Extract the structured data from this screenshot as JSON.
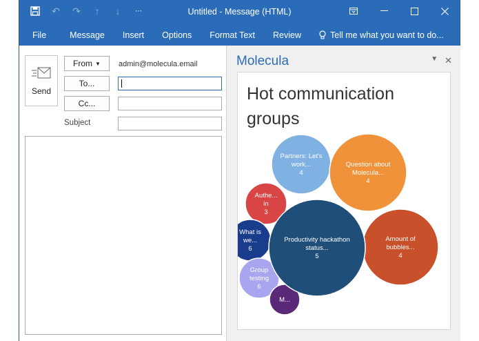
{
  "window": {
    "title": "Untitled - Message (HTML)"
  },
  "icons": [
    "save-icon",
    "undo-icon",
    "redo-icon",
    "up-icon",
    "down-icon",
    "customize-icon",
    "ribbon-display-icon",
    "minimize-icon",
    "maximize-icon",
    "close-icon"
  ],
  "ribbon": {
    "tabs": [
      "File",
      "Message",
      "Insert",
      "Options",
      "Format Text",
      "Review"
    ],
    "tell_me": "Tell me what you want to do..."
  },
  "compose": {
    "send_label": "Send",
    "from_label": "From",
    "from_value": "admin@molecula.email",
    "to_label": "To...",
    "cc_label": "Cc...",
    "subject_label": "Subject"
  },
  "addin": {
    "title": "Molecula",
    "heading": "Hot communication groups",
    "accent": "#2b6cb9"
  },
  "chart_data": {
    "type": "bubble",
    "title": "Hot communication groups",
    "series": [
      {
        "name": "Partners: Let's work...",
        "value": 4,
        "color": "#7fb1e3"
      },
      {
        "name": "Question about Molecula...",
        "value": 4,
        "color": "#f0923a"
      },
      {
        "name": "Authe... in",
        "value": 3,
        "color": "#d94444"
      },
      {
        "name": "Productivity hackathon status...",
        "value": 5,
        "color": "#1f4e79"
      },
      {
        "name": "Amount of bubbles...",
        "value": 4,
        "color": "#c8502a"
      },
      {
        "name": "What is we...",
        "value": 6,
        "color": "#1a3c8c"
      },
      {
        "name": "Group testing",
        "value": 6,
        "color": "#a9a6ef"
      },
      {
        "name": "M...",
        "value": null,
        "color": "#5a2a78"
      }
    ]
  }
}
